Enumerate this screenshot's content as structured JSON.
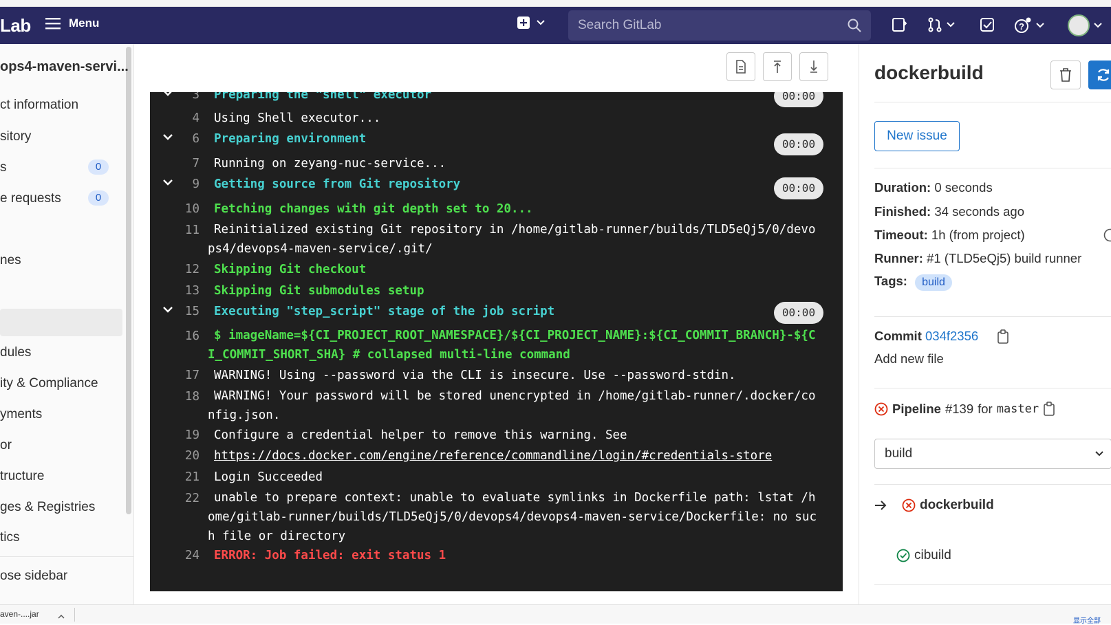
{
  "navbar": {
    "logo": "Lab",
    "menu_label": "Menu",
    "search_placeholder": "Search GitLab"
  },
  "sidebar": {
    "project_name": "ops4-maven-servi...",
    "items": [
      {
        "label": "ct information"
      },
      {
        "label": "sitory"
      },
      {
        "label": "s",
        "badge": "0"
      },
      {
        "label": "e requests",
        "badge": "0"
      },
      {
        "label": ""
      },
      {
        "label": "nes"
      },
      {
        "label": ""
      },
      {
        "label": ""
      },
      {
        "label": "dules"
      },
      {
        "label": "ity & Compliance"
      },
      {
        "label": "yments"
      },
      {
        "label": "or"
      },
      {
        "label": "tructure"
      },
      {
        "label": "ges & Registries"
      },
      {
        "label": "tics"
      }
    ],
    "collapse_label": "ose sidebar"
  },
  "log": {
    "lines": [
      {
        "num": "3",
        "text": "Preparing the \"shell\" executor",
        "cls": "c-section",
        "time": "00:00"
      },
      {
        "num": "4",
        "text": "Using Shell executor...",
        "cls": ""
      },
      {
        "num": "6",
        "text": "Preparing environment",
        "cls": "c-section",
        "time": "00:00"
      },
      {
        "num": "7",
        "text": "Running on zeyang-nuc-service...",
        "cls": ""
      },
      {
        "num": "9",
        "text": "Getting source from Git repository",
        "cls": "c-section",
        "time": "00:00"
      },
      {
        "num": "10",
        "text": "Fetching changes with git depth set to 20...",
        "cls": "c-green"
      },
      {
        "num": "11",
        "text": "Reinitialized existing Git repository in /home/gitlab-runner/builds/TLD5eQj5/0/devops4/devops4-maven-service/.git/",
        "cls": ""
      },
      {
        "num": "12",
        "text": "Skipping Git checkout",
        "cls": "c-green"
      },
      {
        "num": "13",
        "text": "Skipping Git submodules setup",
        "cls": "c-green"
      },
      {
        "num": "15",
        "text": "Executing \"step_script\" stage of the job script",
        "cls": "c-section",
        "time": "00:00"
      },
      {
        "num": "16",
        "text": "$ imageName=${CI_PROJECT_ROOT_NAMESPACE}/${CI_PROJECT_NAME}:${CI_COMMIT_BRANCH}-${CI_COMMIT_SHORT_SHA} # collapsed multi-line command",
        "cls": "c-green"
      },
      {
        "num": "17",
        "text": "WARNING! Using --password via the CLI is insecure. Use --password-stdin.",
        "cls": ""
      },
      {
        "num": "18",
        "text": "WARNING! Your password will be stored unencrypted in /home/gitlab-runner/.docker/config.json.",
        "cls": ""
      },
      {
        "num": "19",
        "text": "Configure a credential helper to remove this warning. See",
        "cls": ""
      },
      {
        "num": "20",
        "text": "https://docs.docker.com/engine/reference/commandline/login/#credentials-store",
        "cls": "c-link"
      },
      {
        "num": "21",
        "text": "Login Succeeded",
        "cls": ""
      },
      {
        "num": "22",
        "text": "unable to prepare context: unable to evaluate symlinks in Dockerfile path: lstat /home/gitlab-runner/builds/TLD5eQj5/0/devops4/devops4-maven-service/Dockerfile: no such file or directory",
        "cls": ""
      },
      {
        "num": "24",
        "text": "ERROR: Job failed: exit status 1",
        "cls": "c-red"
      }
    ]
  },
  "job": {
    "title": "dockerbuild",
    "new_issue_label": "New issue",
    "duration_label": "Duration:",
    "duration_value": "0 seconds",
    "finished_label": "Finished:",
    "finished_value": "34 seconds ago",
    "timeout_label": "Timeout:",
    "timeout_value": "1h (from project)",
    "runner_label": "Runner:",
    "runner_value": "#1 (TLD5eQj5) build runner",
    "tags_label": "Tags:",
    "tag": "build",
    "commit_label": "Commit",
    "commit_sha": "034f2356",
    "commit_message": "Add new file",
    "pipeline_label": "Pipeline",
    "pipeline_id": "#139",
    "pipeline_for": "for",
    "pipeline_branch": "master",
    "stage_select": "build",
    "jobs": [
      {
        "name": "dockerbuild",
        "status": "failed",
        "current": true
      },
      {
        "name": "cibuild",
        "status": "success",
        "current": false
      }
    ]
  },
  "statusbar": {
    "download": "aven-....jar",
    "right_text": "显示全部"
  },
  "colors": {
    "navbar": "#292961",
    "log_bg": "#1f1f1f",
    "link": "#1f75cb",
    "failed": "#dd2b0e",
    "success": "#108548"
  }
}
